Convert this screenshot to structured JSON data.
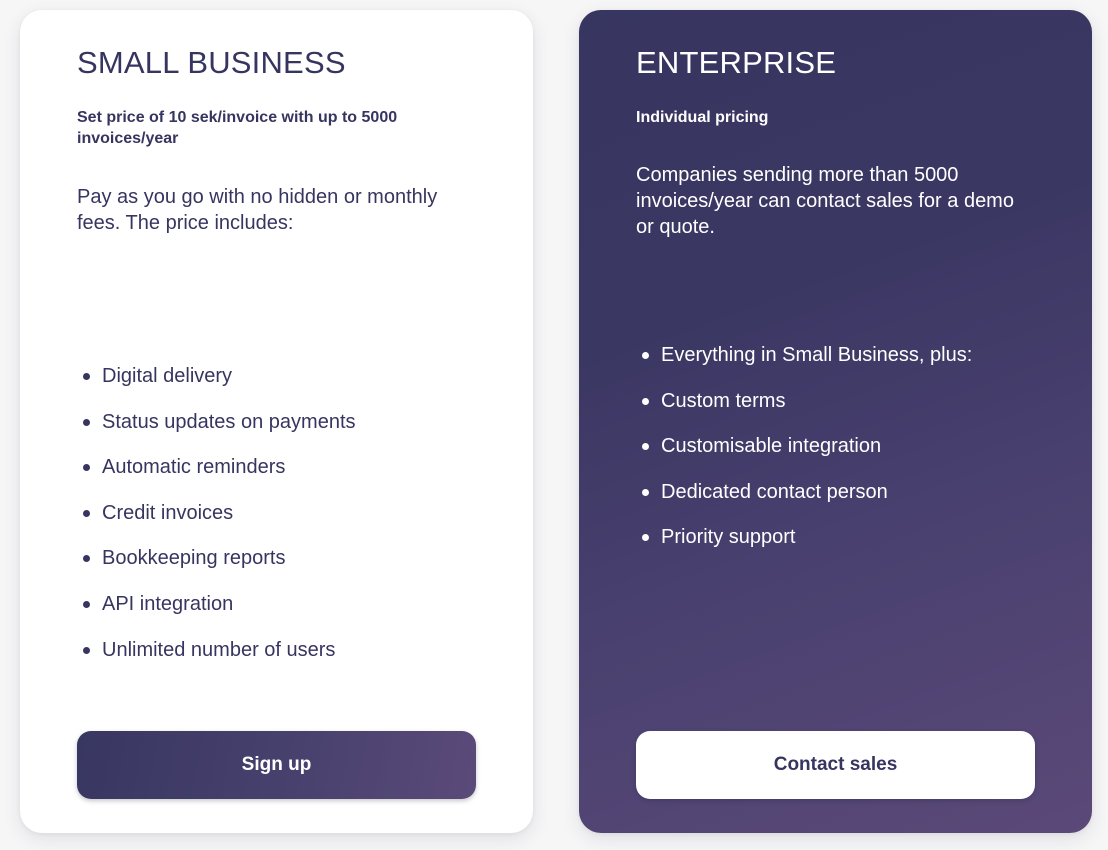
{
  "plans": {
    "small_business": {
      "title": "SMALL BUSINESS",
      "subtitle": "Set price of 10 sek/invoice with up to 5000 invoices/year",
      "description": "Pay as you go with no hidden or monthly fees. The price includes:",
      "features": [
        "Digital delivery",
        "Status updates on payments",
        "Automatic reminders",
        "Credit invoices",
        "Bookkeeping reports",
        "API integration",
        "Unlimited number of users"
      ],
      "button_label": "Sign up"
    },
    "enterprise": {
      "title": "ENTERPRISE",
      "subtitle": "Individual pricing",
      "description": "Companies sending more than 5000 invoices/year can contact sales for a demo or quote.",
      "features": [
        "Everything in Small Business, plus:",
        "Custom terms",
        "Customisable integration",
        "Dedicated contact person",
        "Priority support"
      ],
      "button_label": "Contact sales"
    }
  },
  "colors": {
    "primary_text": "#363560",
    "enterprise_gradient_start": "#373660",
    "enterprise_gradient_end": "#5b4978",
    "card_background": "#ffffff",
    "page_background": "#f6f6f7"
  }
}
